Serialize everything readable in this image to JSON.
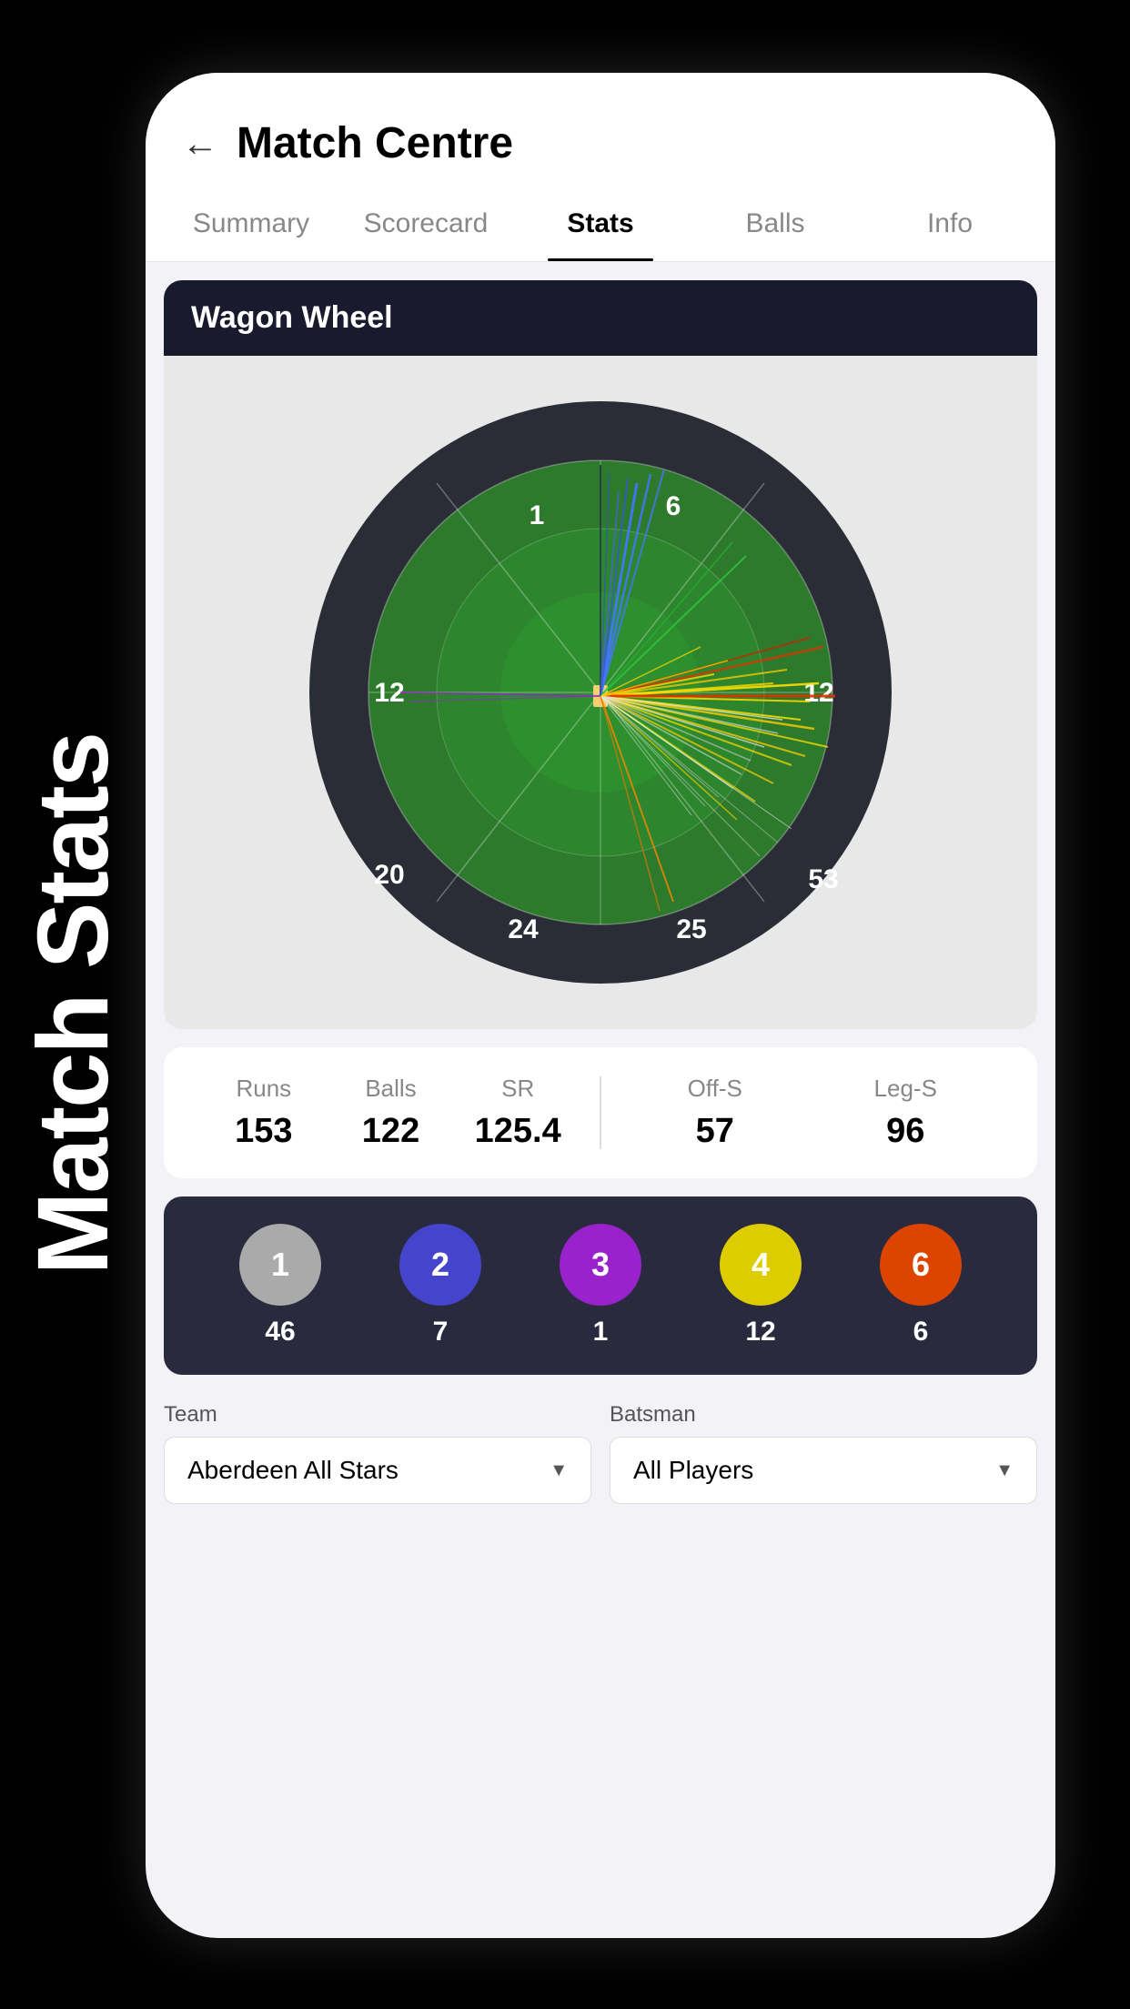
{
  "side_label": "Match Stats",
  "header": {
    "back_icon": "←",
    "title": "Match Centre"
  },
  "tabs": [
    {
      "label": "Summary",
      "active": false
    },
    {
      "label": "Scorecard",
      "active": false
    },
    {
      "label": "Stats",
      "active": true
    },
    {
      "label": "Balls",
      "active": false
    },
    {
      "label": "Info",
      "active": false
    }
  ],
  "wagon_wheel": {
    "title": "Wagon Wheel",
    "sectors": {
      "top_left": "1",
      "top_right": "6",
      "middle_left": "12",
      "middle_right": "12",
      "bottom_left": "20",
      "bottom_right": "53",
      "lower_left": "24",
      "lower_right": "25"
    }
  },
  "stats": {
    "runs_label": "Runs",
    "runs_value": "153",
    "balls_label": "Balls",
    "balls_value": "122",
    "sr_label": "SR",
    "sr_value": "125.4",
    "off_s_label": "Off-S",
    "off_s_value": "57",
    "leg_s_label": "Leg-S",
    "leg_s_value": "96"
  },
  "run_balls": [
    {
      "label": "1",
      "count": "46",
      "color": "#aaaaaa"
    },
    {
      "label": "2",
      "count": "7",
      "color": "#4444cc"
    },
    {
      "label": "3",
      "count": "1",
      "color": "#9922cc"
    },
    {
      "label": "4",
      "count": "12",
      "color": "#ddcc00"
    },
    {
      "label": "6",
      "count": "6",
      "color": "#dd4400"
    }
  ],
  "dropdowns": {
    "team_label": "Team",
    "team_value": "Aberdeen All Stars",
    "batsman_label": "Batsman",
    "batsman_value": "All Players"
  },
  "colors": {
    "active_tab_underline": "#000000",
    "wagon_wheel_header_bg": "#1a1a2e",
    "run_balls_bg": "#2a2a3e"
  }
}
